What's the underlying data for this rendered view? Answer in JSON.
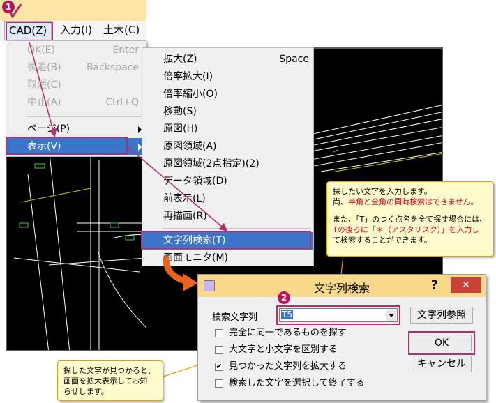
{
  "menubar": {
    "items": [
      "CAD(Z)",
      "入力(I)",
      "土木(C)"
    ]
  },
  "cad_menu": {
    "items": [
      {
        "label": "OK(E)",
        "shortcut": "Enter",
        "enabled": false
      },
      {
        "label": "後退(B)",
        "shortcut": "Backspace",
        "enabled": false
      },
      {
        "label": "取消(C)",
        "shortcut": "",
        "enabled": false
      },
      {
        "label": "中止(A)",
        "shortcut": "Ctrl+Q",
        "enabled": false
      },
      {
        "label": "ページ(P)",
        "shortcut": "",
        "enabled": true
      },
      {
        "label": "表示(V)",
        "shortcut": "",
        "enabled": true
      }
    ]
  },
  "view_menu": {
    "items": [
      {
        "label": "拡大(Z)",
        "shortcut": "Space"
      },
      {
        "label": "倍率拡大(I)",
        "shortcut": ""
      },
      {
        "label": "倍率縮小(O)",
        "shortcut": ""
      },
      {
        "label": "移動(S)",
        "shortcut": ""
      },
      {
        "label": "原図(H)",
        "shortcut": ""
      },
      {
        "label": "原図領域(A)",
        "shortcut": ""
      },
      {
        "label": "原図領域(2点指定)(2)",
        "shortcut": ""
      },
      {
        "label": "データ領域(D)",
        "shortcut": ""
      },
      {
        "label": "前表示(L)",
        "shortcut": ""
      },
      {
        "label": "再描画(R)",
        "shortcut": ""
      },
      {
        "label": "文字列検索(T)",
        "shortcut": ""
      },
      {
        "label": "画面モニタ(M)",
        "shortcut": ""
      }
    ]
  },
  "callout_top": {
    "line1": "探したい文字を入力します。",
    "line2_prefix": "尚、",
    "line2_red": "半角と全角の同時検索はできません。",
    "line3": "また、「T」のつく点名を全て探す場合には、",
    "line4_red": "Tの後ろに「＊（アスタリスク）」を入力し",
    "line5": "て検索することができます。"
  },
  "callout_bottom": {
    "line1": "探した文字が見つかると、",
    "line2": "画面を拡大表示してお知",
    "line3": "らせします。"
  },
  "dialog": {
    "title": "文字列検索",
    "help": "?",
    "search_label": "検索文字列",
    "search_value": "T5",
    "ref_button": "文字列参照",
    "ok_button": "OK",
    "cancel_button": "キャンセル",
    "options": [
      {
        "label": "完全に同一であるものを探す",
        "checked": false
      },
      {
        "label": "大文字と小文字を区別する",
        "checked": false
      },
      {
        "label": "見つかった文字列を拡大する",
        "checked": true
      },
      {
        "label": "検索した文字を選択して終了する",
        "checked": false
      }
    ]
  },
  "steps": [
    "1",
    "2"
  ],
  "colors": {
    "accent": "#b32f6c",
    "menu_highlight": "#3b74c9",
    "callout_bg": "#fffbcc"
  }
}
